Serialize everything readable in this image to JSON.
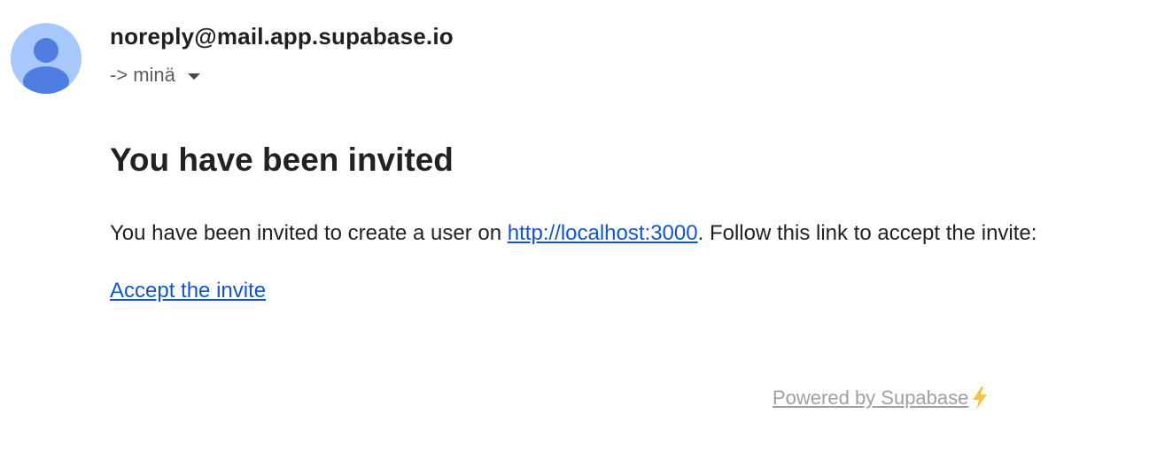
{
  "email": {
    "sender": "noreply@mail.app.supabase.io",
    "recipient_prefix": "->",
    "recipient": "minä",
    "heading": "You have been invited",
    "body_before_link": "You have been invited to create a user on ",
    "body_link": "http://localhost:3000",
    "body_after_link": ". Follow this link to accept the invite:",
    "accept_link": "Accept the invite",
    "footer_text": "Powered by Supabase "
  },
  "icons": {
    "avatar": "person-avatar-icon",
    "recipient_dropdown": "caret-down-icon",
    "bolt": "lightning-bolt-icon"
  },
  "colors": {
    "avatar_bg": "#a8c7fa",
    "avatar_fg": "#4e7fe0",
    "link": "#1155cc",
    "footer": "#a0a0a0",
    "bolt": "#f5c542"
  }
}
